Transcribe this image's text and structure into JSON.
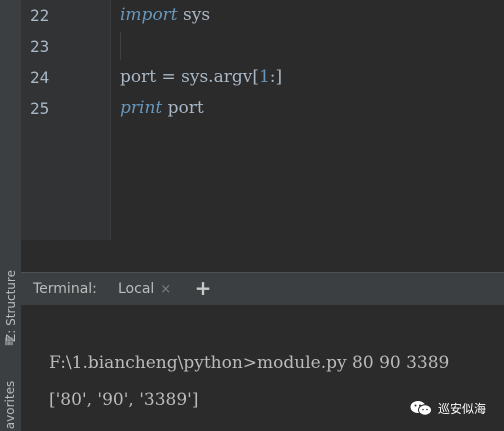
{
  "sidebar": {
    "structure_label": "Z: Structure",
    "favorites_label": "avorites"
  },
  "editor": {
    "lines": [
      {
        "num": "22",
        "import_kw": "import",
        "rest": " sys"
      },
      {
        "num": "23"
      },
      {
        "num": "24",
        "pre": "port = sys.argv[",
        "index": "1",
        "post": ":]"
      },
      {
        "num": "25",
        "print_kw": "print",
        "rest": " port"
      }
    ]
  },
  "terminal": {
    "title": "Terminal:",
    "tab_label": "Local",
    "close_glyph": "×",
    "add_glyph": "+",
    "output": [
      "F:\\1.biancheng\\python>module.py 80 90 3389",
      "['80', '90', '3389']"
    ]
  },
  "watermark": {
    "text": "巡安似海",
    "icon": "wechat-icon"
  }
}
